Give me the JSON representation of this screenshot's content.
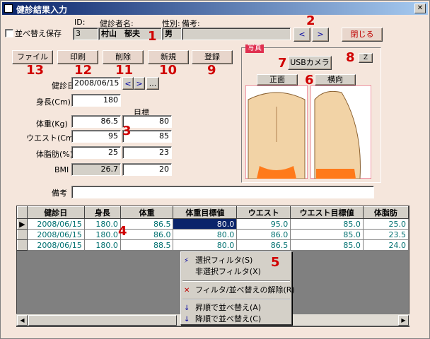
{
  "window": {
    "title": "健診結果入力",
    "close_glyph": "✕"
  },
  "header": {
    "sort_save_label": "並べ替え保存",
    "id_label": "ID:",
    "name_label": "健診者名:",
    "sex_label": "性別:",
    "note_label": "備考:",
    "id_value": "3",
    "name_value": "村山　郁夫",
    "sex_value": "男",
    "note_value": "",
    "prev_glyph": "<",
    "next_glyph": ">",
    "close_label": "閉じる"
  },
  "toolbar": {
    "file_label": "ファイル",
    "print_label": "印刷",
    "delete_label": "削除",
    "new_label": "新規",
    "register_label": "登録"
  },
  "form": {
    "date_label": "健診日",
    "date_value": "2008/06/15",
    "date_prev": "<",
    "date_next": ">",
    "date_more": "...",
    "height_label": "身長(Cm)",
    "height_value": "180",
    "target_label": "目標",
    "weight_label": "体重(Kg)",
    "weight_value": "86.5",
    "weight_target": "80",
    "waist_label": "ウエスト(Cm)",
    "waist_value": "95",
    "waist_target": "85",
    "fat_label": "体脂肪(%)",
    "fat_value": "25",
    "fat_target": "23",
    "bmi_label": "BMI",
    "bmi_value": "26.7",
    "bmi_target": "20",
    "remark_label": "備考",
    "remark_value": ""
  },
  "photo": {
    "tag": "写真",
    "usb_label": "USBカメラ",
    "z_label": "Z",
    "front_label": "正面",
    "side_label": "横向"
  },
  "grid": {
    "columns": [
      "健診日",
      "身長",
      "体重",
      "体重目標値",
      "ウエスト",
      "ウエスト目標値",
      "体脂肪"
    ],
    "rows": [
      {
        "marker": "▶",
        "cells": [
          "2008/06/15",
          "180.0",
          "86.5",
          "80.0",
          "95.0",
          "85.0",
          "25.0"
        ]
      },
      {
        "marker": "",
        "cells": [
          "2008/06/15",
          "180.0",
          "86.0",
          "80.0",
          "86.0",
          "85.0",
          "23.5"
        ]
      },
      {
        "marker": "",
        "cells": [
          "2008/06/15",
          "180.0",
          "88.5",
          "80.0",
          "86.5",
          "85.0",
          "24.0"
        ]
      }
    ]
  },
  "context_menu": {
    "items": [
      {
        "icon": "filter-selection-icon",
        "glyph": "⚡",
        "label": "選択フィルタ(S)"
      },
      {
        "icon": "",
        "glyph": "",
        "label": "非選択フィルタ(X)"
      },
      {
        "icon": "remove-filter-icon",
        "glyph": "✕",
        "label": "フィルタ/並べ替えの解除(R)"
      },
      {
        "icon": "sort-asc-icon",
        "glyph": "↓",
        "label": "昇順で並べ替え(A)"
      },
      {
        "icon": "sort-desc-icon",
        "glyph": "↓",
        "label": "降順で並べ替え(C)"
      }
    ]
  },
  "annotations": [
    "1",
    "2",
    "3",
    "4",
    "5",
    "6",
    "7",
    "8",
    "9",
    "10",
    "11",
    "12",
    "13"
  ],
  "colors": {
    "accent_red": "#d00000",
    "photo_tag": "#e03050",
    "title_blue": "#0a246a",
    "body_peach": "#f5e6dc"
  }
}
